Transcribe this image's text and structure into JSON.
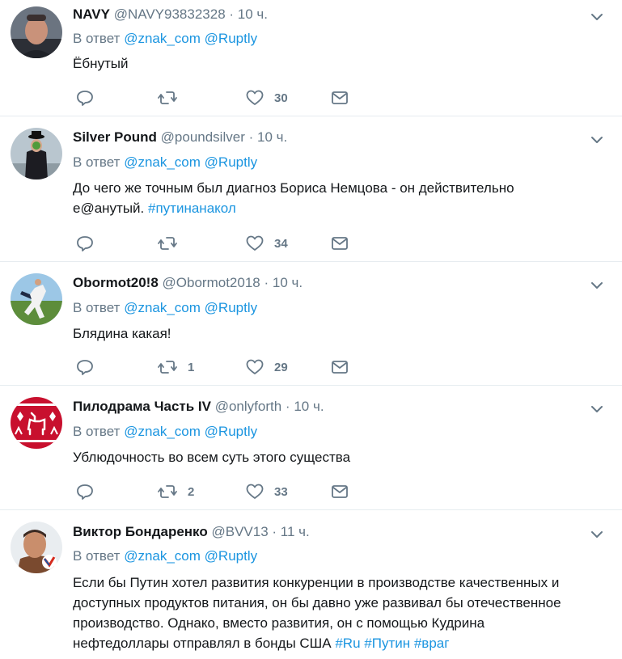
{
  "reply_prefix": "В ответ",
  "tweets": [
    {
      "name": "NAVY",
      "handle": "@NAVY93832328",
      "dot": "·",
      "time": "10 ч.",
      "mentions": [
        "@znak_com",
        "@Ruptly"
      ],
      "text": "Ёбнутый",
      "hashtags": [],
      "retweets": "",
      "likes": "30"
    },
    {
      "name": "Silver Pound",
      "handle": "@poundsilver",
      "dot": "·",
      "time": "10 ч.",
      "mentions": [
        "@znak_com",
        "@Ruptly"
      ],
      "text_line1": "До чего же точным был диагноз Бориса Немцова - он действительно",
      "text_line2": "е@анутый.",
      "hashtags": [
        "#путинанакол"
      ],
      "retweets": "",
      "likes": "34"
    },
    {
      "name": "Obormot20!8",
      "handle": "@Obormot2018",
      "dot": "·",
      "time": "10 ч.",
      "mentions": [
        "@znak_com",
        "@Ruptly"
      ],
      "text": "Блядина какая!",
      "hashtags": [],
      "retweets": "1",
      "likes": "29"
    },
    {
      "name": "Пилодрама Часть IV",
      "handle": "@onlyforth",
      "dot": "·",
      "time": "10 ч.",
      "mentions": [
        "@znak_com",
        "@Ruptly"
      ],
      "text": "Ублюдочность во всем суть этого существа",
      "hashtags": [],
      "retweets": "2",
      "likes": "33"
    },
    {
      "name": "Виктор Бондаренко",
      "handle": "@BVV13",
      "dot": "·",
      "time": "11 ч.",
      "mentions": [
        "@znak_com",
        "@Ruptly"
      ],
      "text_line1": "Если бы Путин хотел развития конкуренции в производстве качественных и",
      "text_line2": "доступных продуктов питания, он бы давно уже развивал бы отечественное",
      "text_line3": "производство. Однако, вместо развития, он с помощью Кудрина",
      "text_line4": "нефтедоллары отправлял в бонды США",
      "hashtags": [
        "#Ru",
        "#Путин",
        "#враг"
      ]
    }
  ],
  "icons": {
    "reply": "reply-icon",
    "retweet": "retweet-icon",
    "like": "heart-icon",
    "dm": "envelope-icon",
    "menu": "chevron-down-icon"
  },
  "colors": {
    "link": "#1b95e0",
    "secondary": "#657786",
    "divider": "#e6ecf0"
  }
}
